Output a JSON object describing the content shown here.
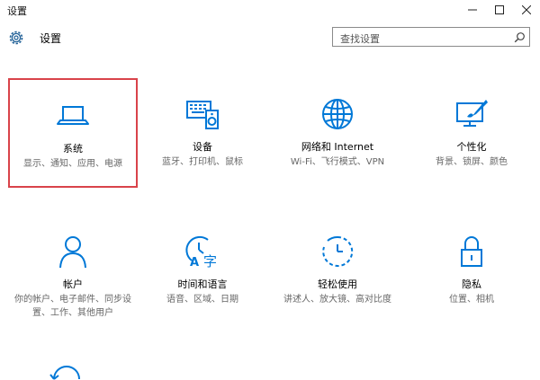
{
  "window": {
    "title": "设置"
  },
  "header": {
    "title": "设置",
    "search_placeholder": "查找设置"
  },
  "tiles": [
    {
      "title": "系统",
      "desc": "显示、通知、应用、电源"
    },
    {
      "title": "设备",
      "desc": "蓝牙、打印机、鼠标"
    },
    {
      "title": "网络和 Internet",
      "desc": "Wi-Fi、飞行模式、VPN"
    },
    {
      "title": "个性化",
      "desc": "背景、锁屏、颜色"
    },
    {
      "title": "帐户",
      "desc": "你的帐户、电子邮件、同步设置、工作、其他用户"
    },
    {
      "title": "时间和语言",
      "desc": "语音、区域、日期"
    },
    {
      "title": "轻松使用",
      "desc": "讲述人、放大镜、高对比度"
    },
    {
      "title": "隐私",
      "desc": "位置、相机"
    }
  ],
  "colors": {
    "accent": "#0078d7",
    "selection": "#d9434a"
  }
}
